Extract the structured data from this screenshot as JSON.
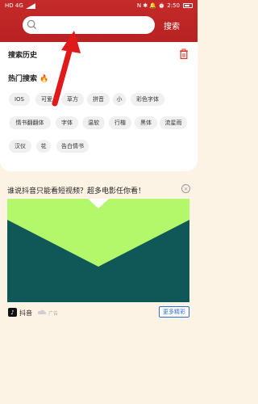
{
  "status_bar": {
    "left_text": "HD 4G",
    "right_text": "N ✱ 🔔 ⏰ 2:50",
    "time": "2:50"
  },
  "search": {
    "placeholder": "",
    "value": "",
    "button_label": "搜索"
  },
  "history": {
    "title": "搜索历史"
  },
  "hot": {
    "title": "热门搜索",
    "tags": [
      "IOS",
      "可爱",
      "草方",
      "拼音",
      "小",
      "彩色字体",
      "情书翻翻体",
      "字体",
      "温软",
      "行楷",
      "黑体",
      "流星雨",
      "汉仪",
      "花",
      "告白情书"
    ]
  },
  "ad": {
    "title": "谁说抖音只能看短视频？超多电影任你看！",
    "brand": "抖音",
    "badge": "广告",
    "more_label": "更多精彩",
    "close_symbol": "×",
    "colors": {
      "image_top": "#b3f76a",
      "image_bottom": "#105858"
    }
  },
  "colors": {
    "header": "#c42a2a",
    "background": "#fdf3e5",
    "arrow": "#e01a1a"
  }
}
